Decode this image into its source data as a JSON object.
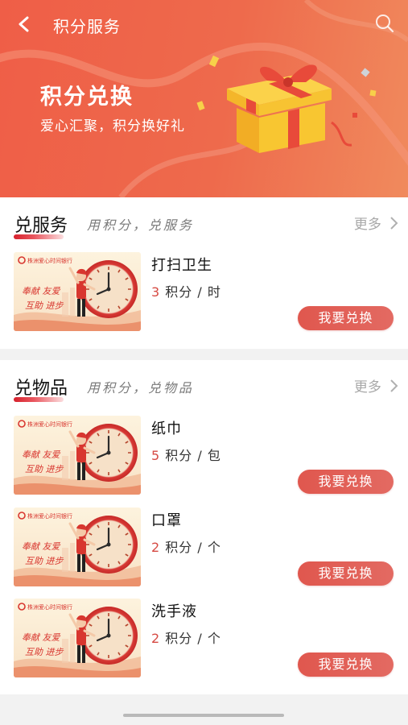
{
  "header": {
    "title": "积分服务",
    "back_icon": "chevron-left-icon",
    "search_icon": "search-icon"
  },
  "banner": {
    "title": "积分兑换",
    "subtitle": "爱心汇聚，积分换好礼",
    "colors": {
      "background": "#ef5e47",
      "gift_box": "#f7c12b",
      "gift_ribbon": "#e84a3a"
    }
  },
  "sections": [
    {
      "title": "兑服务",
      "slogan": "用积分，兑服务",
      "more_label": "更多",
      "items": [
        {
          "name": "打扫卫生",
          "points": "3",
          "unit": "积分 / 时",
          "button_label": "我要兑换"
        }
      ]
    },
    {
      "title": "兑物品",
      "slogan": "用积分，兑物品",
      "more_label": "更多",
      "items": [
        {
          "name": "纸巾",
          "points": "5",
          "unit": "积分 / 包",
          "button_label": "我要兑换"
        },
        {
          "name": "口罩",
          "points": "2",
          "unit": "积分 / 个",
          "button_label": "我要兑换"
        },
        {
          "name": "洗手液",
          "points": "2",
          "unit": "积分 / 个",
          "button_label": "我要兑换"
        }
      ]
    }
  ],
  "thumbnail": {
    "bank_name": "株洲爱心时间银行",
    "slogan_line1": "奉献 友爱",
    "slogan_line2": "互助 进步"
  },
  "colors": {
    "accent": "#e0574e",
    "points_number": "#d64a43"
  }
}
